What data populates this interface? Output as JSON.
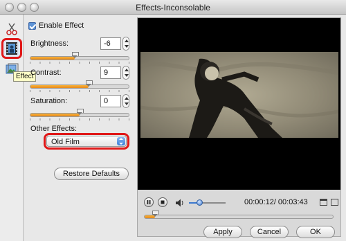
{
  "window": {
    "title": "Effects-Inconsolable"
  },
  "toolbar": {
    "tools": [
      {
        "icon": "scissors-icon"
      },
      {
        "icon": "film-effect-icon"
      },
      {
        "icon": "image-crop-icon"
      }
    ],
    "tooltip": "Effect"
  },
  "effects": {
    "enable_label": "Enable Effect",
    "enabled": true,
    "brightness": {
      "label": "Brightness:",
      "value": "-6",
      "level": 0.45
    },
    "contrast": {
      "label": "Contrast:",
      "value": "9",
      "level": 0.59
    },
    "saturation": {
      "label": "Saturation:",
      "value": "0",
      "level": 0.5
    },
    "other_label": "Other Effects:",
    "other_selected": "Old Film",
    "restore_label": "Restore Defaults"
  },
  "player": {
    "time": "00:00:12/ 00:03:43",
    "volume_level": 0.28,
    "progress": 0.054
  },
  "buttons": {
    "apply": "Apply",
    "cancel": "Cancel",
    "ok": "OK"
  },
  "colors": {
    "accent_orange": "#f2a02b",
    "highlight_red": "#e01818",
    "blue": "#3b78cf"
  }
}
